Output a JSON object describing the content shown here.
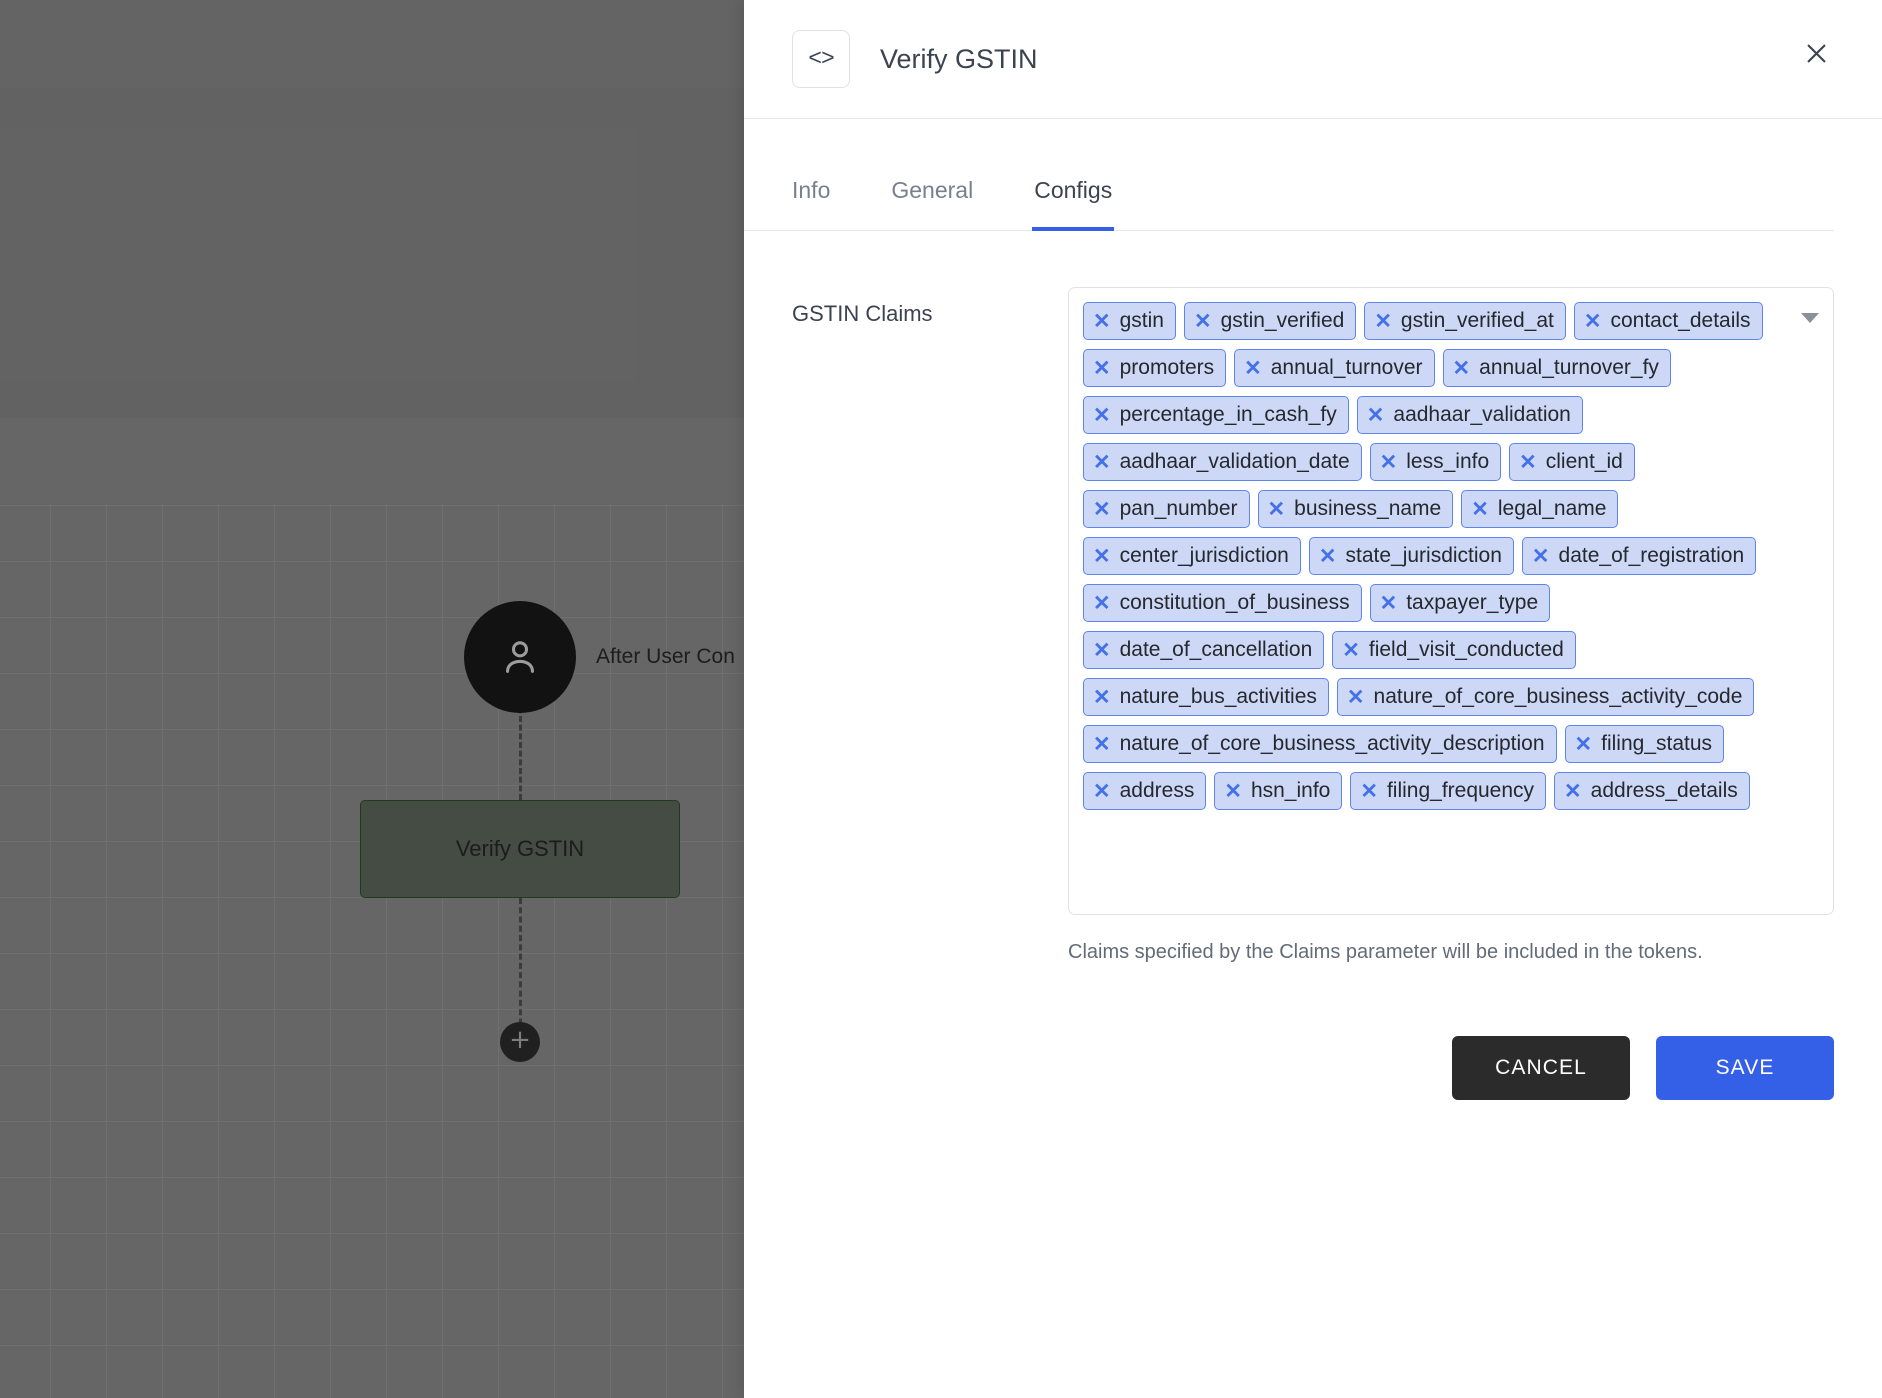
{
  "canvas": {
    "user_node": {
      "icon": "user-avatar-icon",
      "label": "After User Con"
    },
    "task_node": {
      "label": "Verify GSTIN"
    },
    "add_node_button": {
      "icon": "plus-icon",
      "glyph": "+"
    }
  },
  "panel": {
    "header": {
      "icon": "code-brackets-icon",
      "icon_glyph": "<>",
      "title": "Verify GSTIN",
      "close_icon": "close-icon"
    },
    "tabs": [
      {
        "label": "Info",
        "active": false
      },
      {
        "label": "General",
        "active": false
      },
      {
        "label": "Configs",
        "active": true
      }
    ],
    "field": {
      "label": "GSTIN Claims",
      "dropdown_icon": "chevron-down-icon",
      "chips": [
        "gstin",
        "gstin_verified",
        "gstin_verified_at",
        "contact_details",
        "promoters",
        "annual_turnover",
        "annual_turnover_fy",
        "percentage_in_cash_fy",
        "aadhaar_validation",
        "aadhaar_validation_date",
        "less_info",
        "client_id",
        "pan_number",
        "business_name",
        "legal_name",
        "center_jurisdiction",
        "state_jurisdiction",
        "date_of_registration",
        "constitution_of_business",
        "taxpayer_type",
        "date_of_cancellation",
        "field_visit_conducted",
        "nature_bus_activities",
        "nature_of_core_business_activity_code",
        "nature_of_core_business_activity_description",
        "filing_status",
        "address",
        "hsn_info",
        "filing_frequency",
        "address_details"
      ],
      "chip_remove_glyph": "✕",
      "helper_text": "Claims specified by the Claims parameter will be included in the tokens."
    },
    "actions": {
      "cancel_label": "CANCEL",
      "save_label": "SAVE"
    }
  },
  "colors": {
    "accent": "#3460e8",
    "chip_bg": "#cdd8f7",
    "chip_border": "#5f84ec",
    "cancel_bg": "#2b2b2b",
    "node_green": "#5d6b5d"
  }
}
